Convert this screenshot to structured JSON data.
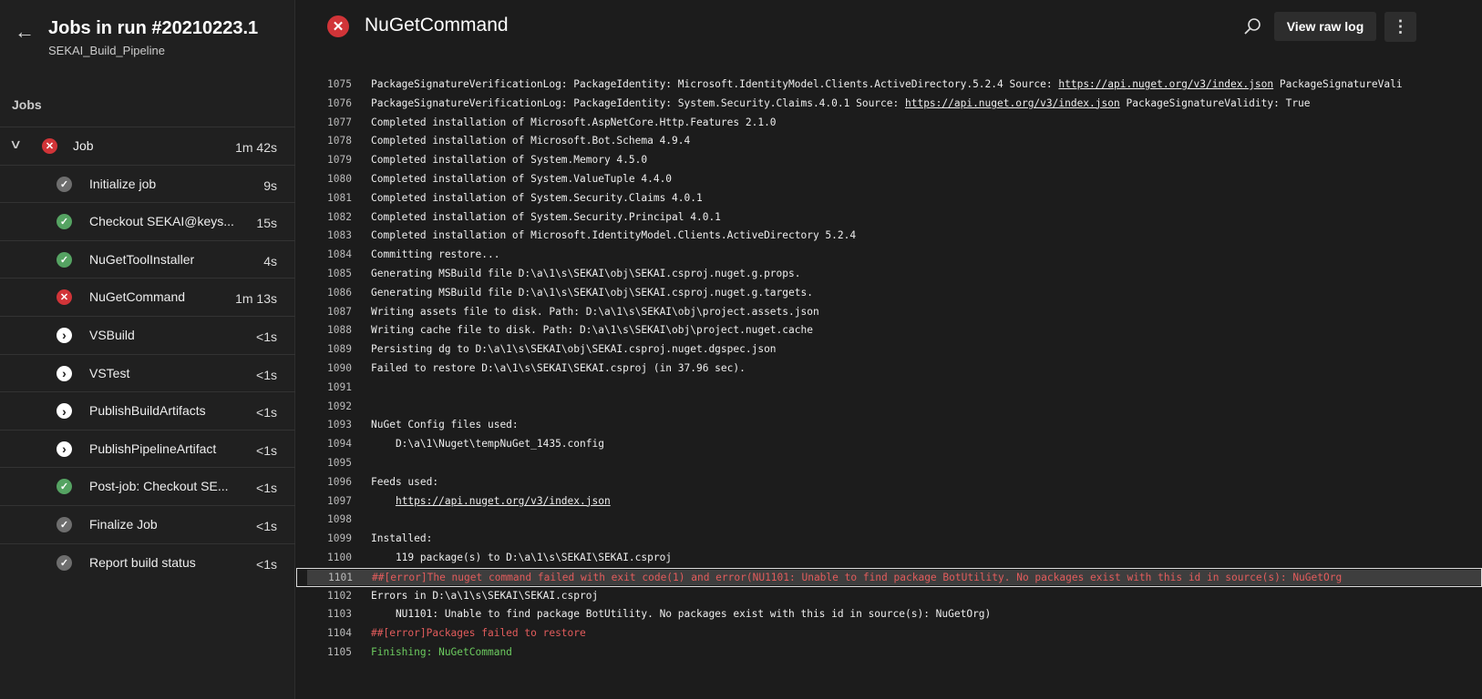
{
  "sidebar": {
    "title": "Jobs in run #20210223.1",
    "subtitle": "SEKAI_Build_Pipeline",
    "section": "Jobs",
    "job": {
      "label": "Job",
      "duration": "1m 42s",
      "status": "failed"
    },
    "steps": [
      {
        "label": "Initialize job",
        "duration": "9s",
        "status": "succeeded-gray"
      },
      {
        "label": "Checkout SEKAI@keys...",
        "duration": "15s",
        "status": "succeeded"
      },
      {
        "label": "NuGetToolInstaller",
        "duration": "4s",
        "status": "succeeded"
      },
      {
        "label": "NuGetCommand",
        "duration": "1m 13s",
        "status": "failed"
      },
      {
        "label": "VSBuild",
        "duration": "<1s",
        "status": "skipped"
      },
      {
        "label": "VSTest",
        "duration": "<1s",
        "status": "skipped"
      },
      {
        "label": "PublishBuildArtifacts",
        "duration": "<1s",
        "status": "skipped"
      },
      {
        "label": "PublishPipelineArtifact",
        "duration": "<1s",
        "status": "skipped"
      },
      {
        "label": "Post-job: Checkout SE...",
        "duration": "<1s",
        "status": "succeeded"
      },
      {
        "label": "Finalize Job",
        "duration": "<1s",
        "status": "succeeded-gray"
      },
      {
        "label": "Report build status",
        "duration": "<1s",
        "status": "succeeded-gray"
      }
    ]
  },
  "header": {
    "title": "NuGetCommand",
    "status": "failed",
    "view_raw_log": "View raw log",
    "more": "⋮"
  },
  "colors": {
    "failed": "#d13438",
    "succeeded": "#55a362",
    "succeeded-gray": "#6e6e6e",
    "skipped": "#ffffff"
  },
  "log": [
    {
      "n": "1075",
      "parts": [
        {
          "t": "PackageSignatureVerificationLog: PackageIdentity: Microsoft.IdentityModel.Clients.ActiveDirectory.5.2.4 Source: "
        },
        {
          "t": "https://api.nuget.org/v3/index.json",
          "link": true
        },
        {
          "t": " PackageSignatureVali"
        }
      ]
    },
    {
      "n": "1076",
      "parts": [
        {
          "t": "PackageSignatureVerificationLog: PackageIdentity: System.Security.Claims.4.0.1 Source: "
        },
        {
          "t": "https://api.nuget.org/v3/index.json",
          "link": true
        },
        {
          "t": " PackageSignatureValidity: True"
        }
      ]
    },
    {
      "n": "1077",
      "parts": [
        {
          "t": "Completed installation of Microsoft.AspNetCore.Http.Features 2.1.0"
        }
      ]
    },
    {
      "n": "1078",
      "parts": [
        {
          "t": "Completed installation of Microsoft.Bot.Schema 4.9.4"
        }
      ]
    },
    {
      "n": "1079",
      "parts": [
        {
          "t": "Completed installation of System.Memory 4.5.0"
        }
      ]
    },
    {
      "n": "1080",
      "parts": [
        {
          "t": "Completed installation of System.ValueTuple 4.4.0"
        }
      ]
    },
    {
      "n": "1081",
      "parts": [
        {
          "t": "Completed installation of System.Security.Claims 4.0.1"
        }
      ]
    },
    {
      "n": "1082",
      "parts": [
        {
          "t": "Completed installation of System.Security.Principal 4.0.1"
        }
      ]
    },
    {
      "n": "1083",
      "parts": [
        {
          "t": "Completed installation of Microsoft.IdentityModel.Clients.ActiveDirectory 5.2.4"
        }
      ]
    },
    {
      "n": "1084",
      "parts": [
        {
          "t": "Committing restore..."
        }
      ]
    },
    {
      "n": "1085",
      "parts": [
        {
          "t": "Generating MSBuild file D:\\a\\1\\s\\SEKAI\\obj\\SEKAI.csproj.nuget.g.props."
        }
      ]
    },
    {
      "n": "1086",
      "parts": [
        {
          "t": "Generating MSBuild file D:\\a\\1\\s\\SEKAI\\obj\\SEKAI.csproj.nuget.g.targets."
        }
      ]
    },
    {
      "n": "1087",
      "parts": [
        {
          "t": "Writing assets file to disk. Path: D:\\a\\1\\s\\SEKAI\\obj\\project.assets.json"
        }
      ]
    },
    {
      "n": "1088",
      "parts": [
        {
          "t": "Writing cache file to disk. Path: D:\\a\\1\\s\\SEKAI\\obj\\project.nuget.cache"
        }
      ]
    },
    {
      "n": "1089",
      "parts": [
        {
          "t": "Persisting dg to D:\\a\\1\\s\\SEKAI\\obj\\SEKAI.csproj.nuget.dgspec.json"
        }
      ]
    },
    {
      "n": "1090",
      "parts": [
        {
          "t": "Failed to restore D:\\a\\1\\s\\SEKAI\\SEKAI.csproj (in 37.96 sec)."
        }
      ]
    },
    {
      "n": "1091",
      "parts": []
    },
    {
      "n": "1092",
      "parts": []
    },
    {
      "n": "1093",
      "parts": [
        {
          "t": "NuGet Config files used:"
        }
      ]
    },
    {
      "n": "1094",
      "parts": [
        {
          "t": "    D:\\a\\1\\Nuget\\tempNuGet_1435.config"
        }
      ]
    },
    {
      "n": "1095",
      "parts": []
    },
    {
      "n": "1096",
      "parts": [
        {
          "t": "Feeds used:"
        }
      ]
    },
    {
      "n": "1097",
      "parts": [
        {
          "t": "    "
        },
        {
          "t": "https://api.nuget.org/v3/index.json",
          "link": true
        }
      ]
    },
    {
      "n": "1098",
      "parts": []
    },
    {
      "n": "1099",
      "parts": [
        {
          "t": "Installed:"
        }
      ]
    },
    {
      "n": "1100",
      "parts": [
        {
          "t": "    119 package(s) to D:\\a\\1\\s\\SEKAI\\SEKAI.csproj"
        }
      ]
    },
    {
      "n": "1101",
      "type": "error",
      "highlight": true,
      "parts": [
        {
          "t": "##[error]The nuget command failed with exit code(1) and error(NU1101: Unable to find package BotUtility. No packages exist with this id in source(s): NuGetOrg"
        }
      ]
    },
    {
      "n": "1102",
      "parts": [
        {
          "t": "Errors in D:\\a\\1\\s\\SEKAI\\SEKAI.csproj"
        }
      ]
    },
    {
      "n": "1103",
      "parts": [
        {
          "t": "    NU1101: Unable to find package BotUtility. No packages exist with this id in source(s): NuGetOrg)"
        }
      ]
    },
    {
      "n": "1104",
      "type": "error",
      "parts": [
        {
          "t": "##[error]Packages failed to restore"
        }
      ]
    },
    {
      "n": "1105",
      "type": "success",
      "parts": [
        {
          "t": "Finishing: NuGetCommand"
        }
      ]
    }
  ]
}
